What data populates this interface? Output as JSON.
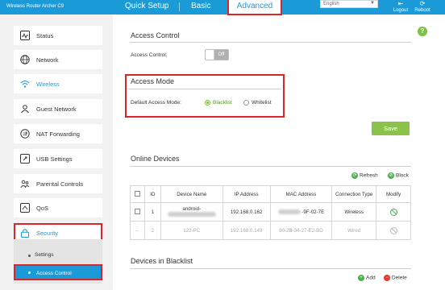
{
  "header": {
    "brand": "Wireless Router Archer C9",
    "tabs": [
      "Quick Setup",
      "Basic",
      "Advanced"
    ],
    "language": "English",
    "logout": "Logout",
    "reboot": "Reboot"
  },
  "sidebar": {
    "items": [
      {
        "label": "Status",
        "icon": "pulse-icon"
      },
      {
        "label": "Network",
        "icon": "globe-icon"
      },
      {
        "label": "Wireless",
        "icon": "wifi-icon"
      },
      {
        "label": "Guest Network",
        "icon": "guest-icon"
      },
      {
        "label": "NAT Forwarding",
        "icon": "nat-icon"
      },
      {
        "label": "USB Settings",
        "icon": "usb-icon"
      },
      {
        "label": "Parental Controls",
        "icon": "parental-icon"
      },
      {
        "label": "QoS",
        "icon": "qos-icon"
      },
      {
        "label": "Security",
        "icon": "lock-icon"
      }
    ],
    "sub_items": [
      "Settings",
      "Access Control"
    ]
  },
  "access_control": {
    "title": "Access Control",
    "label": "Access Control:",
    "toggle_state": "Off"
  },
  "access_mode": {
    "title": "Access Mode",
    "label": "Default Access Mode:",
    "options": [
      "Blacklist",
      "Whitelist"
    ],
    "selected": "Blacklist"
  },
  "save_label": "Save",
  "online_devices": {
    "title": "Online Devices",
    "refresh": "Refresh",
    "block": "Block",
    "columns": [
      "ID",
      "Device Name",
      "IP Address",
      "MAC Address",
      "Connection Type",
      "Modify"
    ],
    "rows": [
      {
        "id": "1",
        "name": "android-",
        "ip": "192.168.0.162",
        "mac": "-9F-02-7E",
        "type": "Wireless"
      },
      {
        "id": "2",
        "name": "123-PC",
        "ip": "192.168.0.149",
        "mac": "90-2B-34-27-E2-BD",
        "type": "Wired"
      }
    ],
    "row2_checkbox": "--"
  },
  "blacklist": {
    "title": "Devices in Blacklist",
    "add": "Add",
    "delete": "Delete"
  },
  "colors": {
    "brand_blue": "#1a9bd7",
    "highlight_red": "#d9262c",
    "save_green": "#8bc34a"
  }
}
